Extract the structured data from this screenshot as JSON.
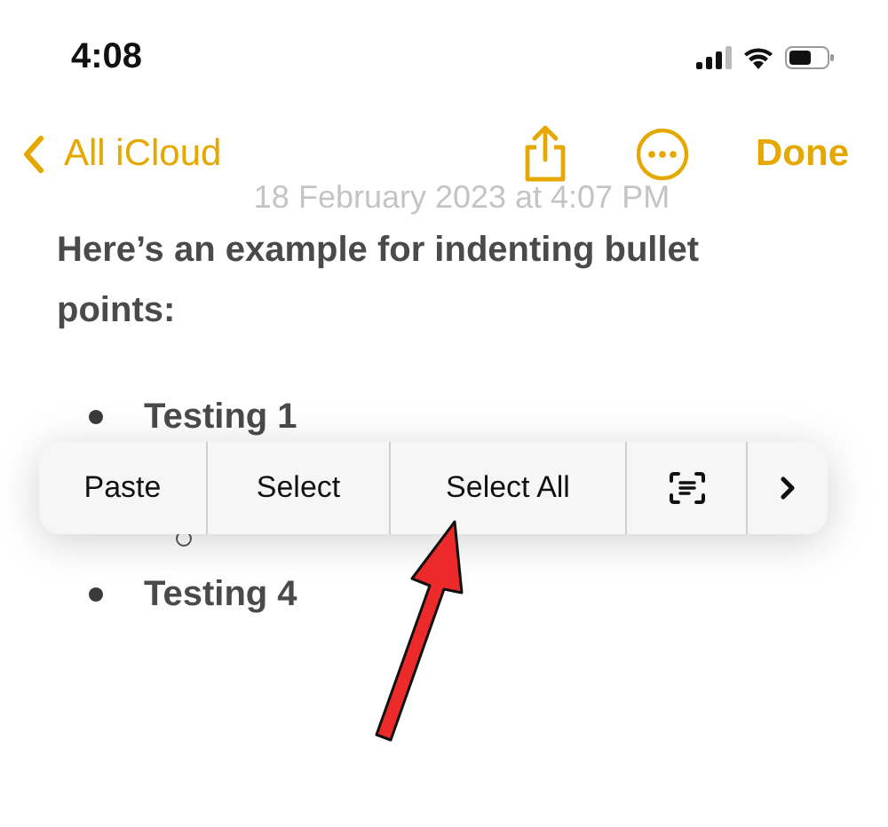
{
  "status_bar": {
    "time": "4:08"
  },
  "nav": {
    "back": "All iCloud",
    "done": "Done"
  },
  "note": {
    "date": "18 February 2023 at 4:07 PM",
    "paragraph": "Here’s an example for indenting bullet points:",
    "bullets": [
      {
        "text": "Testing 1",
        "children": [
          {
            "kind": "hollow"
          }
        ]
      },
      {
        "text": "Testing 4"
      }
    ]
  },
  "edit_menu": {
    "items": [
      {
        "kind": "text",
        "label": "Paste"
      },
      {
        "kind": "text",
        "label": "Select"
      },
      {
        "kind": "text",
        "label": "Select All"
      },
      {
        "kind": "scan"
      },
      {
        "kind": "more"
      }
    ]
  }
}
